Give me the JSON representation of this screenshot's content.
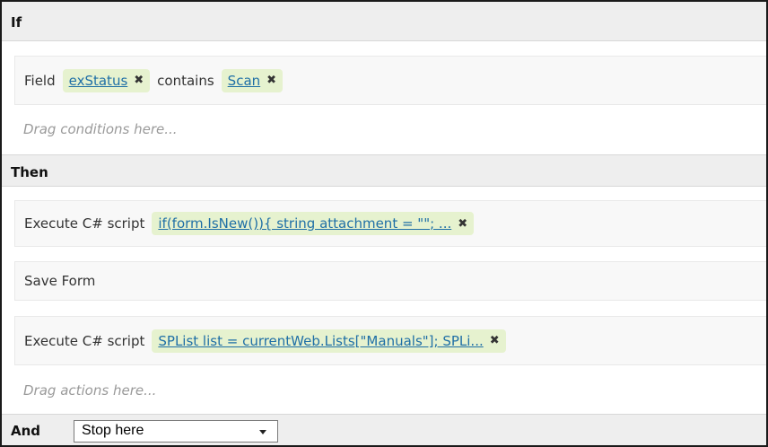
{
  "if_section": {
    "title": "If",
    "condition": {
      "prefix": "Field",
      "field_token": "exStatus",
      "operator": "contains",
      "value_token": "Scan"
    },
    "placeholder": "Drag conditions here..."
  },
  "then_section": {
    "title": "Then",
    "actions": [
      {
        "label": "Execute C# script",
        "token": "if(form.IsNew()){ string attachment = \"\"; ..."
      },
      {
        "label": "Save Form"
      },
      {
        "label": "Execute C# script",
        "token": "SPList list = currentWeb.Lists[\"Manuals\"]; SPLi..."
      }
    ],
    "placeholder": "Drag actions here..."
  },
  "and_section": {
    "label": "And",
    "selected": "Stop here"
  },
  "icons": {
    "remove": "close-icon",
    "dropdown": "chevron-down-icon"
  },
  "colors": {
    "token_bg": "#e6f2cf",
    "link": "#1f6fa6",
    "header_bg": "#eeeeee",
    "row_bg": "#f8f8f8",
    "placeholder": "#9a9a9a"
  }
}
